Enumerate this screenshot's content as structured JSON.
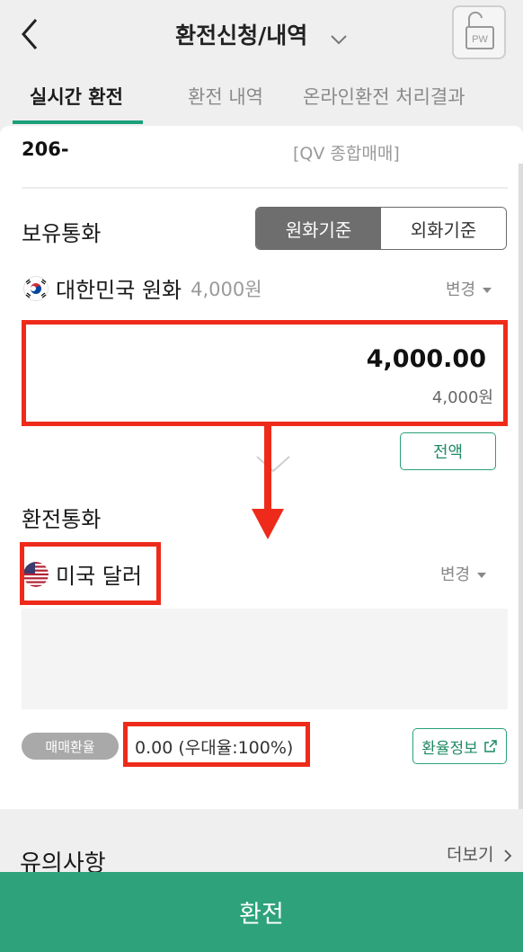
{
  "header": {
    "title": "환전신청/내역",
    "pw_label": "PW"
  },
  "tabs": [
    {
      "label": "실시간 환전",
      "active": true
    },
    {
      "label": "환전 내역",
      "active": false
    },
    {
      "label": "온라인환전 처리결과",
      "active": false
    }
  ],
  "account": {
    "number": "206-",
    "type": "[QV 종합매매]"
  },
  "holding": {
    "section_title": "보유통화",
    "toggle": {
      "won_label": "원화기준",
      "foreign_label": "외화기준",
      "selected": "원화기준"
    },
    "currency_name": "대한민국 원화",
    "balance": "4,000원",
    "change_label": "변경",
    "amount": "4,000.00",
    "amount_won": "4,000원",
    "all_label": "전액"
  },
  "target": {
    "section_title": "환전통화",
    "currency_name": "미국 달러",
    "change_label": "변경"
  },
  "rate": {
    "badge_label": "매매환율",
    "value": "0.00 (우대율:100%)",
    "info_label": "환율정보"
  },
  "notice": {
    "title": "유의사항",
    "more_label": "더보기"
  },
  "submit_label": "환전",
  "colors": {
    "accent": "#2ea37b",
    "highlight": "#ee2b1b"
  }
}
